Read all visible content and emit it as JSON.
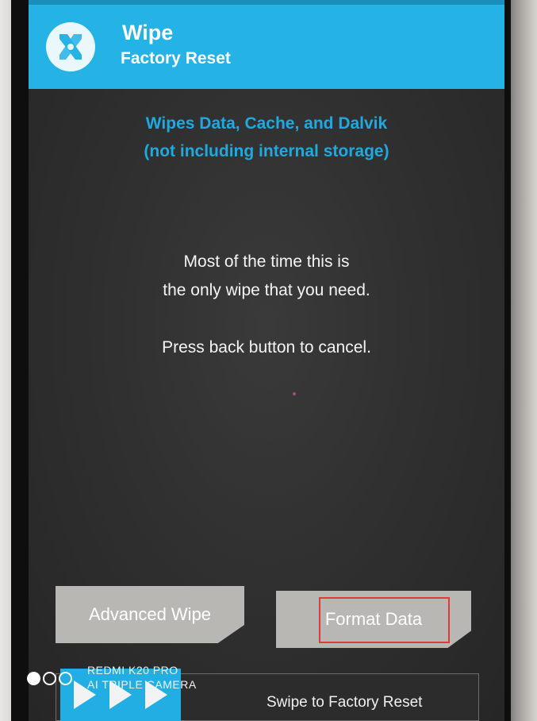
{
  "header": {
    "title": "Wipe",
    "subtitle": "Factory Reset",
    "logo_icon": "twrp-logo-icon",
    "color": "#25b3e6"
  },
  "info": {
    "line1": "Wipes Data, Cache, and Dalvik",
    "line2": "(not including internal storage)",
    "color": "#1fa9e1"
  },
  "message": {
    "line1": "Most of the time this is",
    "line2": "the only wipe that you need.",
    "line3": "Press back button to cancel."
  },
  "buttons": {
    "advanced_wipe": "Advanced Wipe",
    "format_data": "Format Data"
  },
  "swipe": {
    "label": "Swipe to Factory Reset",
    "arrow_icon": "swipe-arrow-icon"
  },
  "annotation": {
    "color": "#e03a3a",
    "target": "Format Data"
  },
  "watermark": {
    "line1": "REDMI K20 PRO",
    "line2": "AI TRIPLE CAMERA"
  }
}
